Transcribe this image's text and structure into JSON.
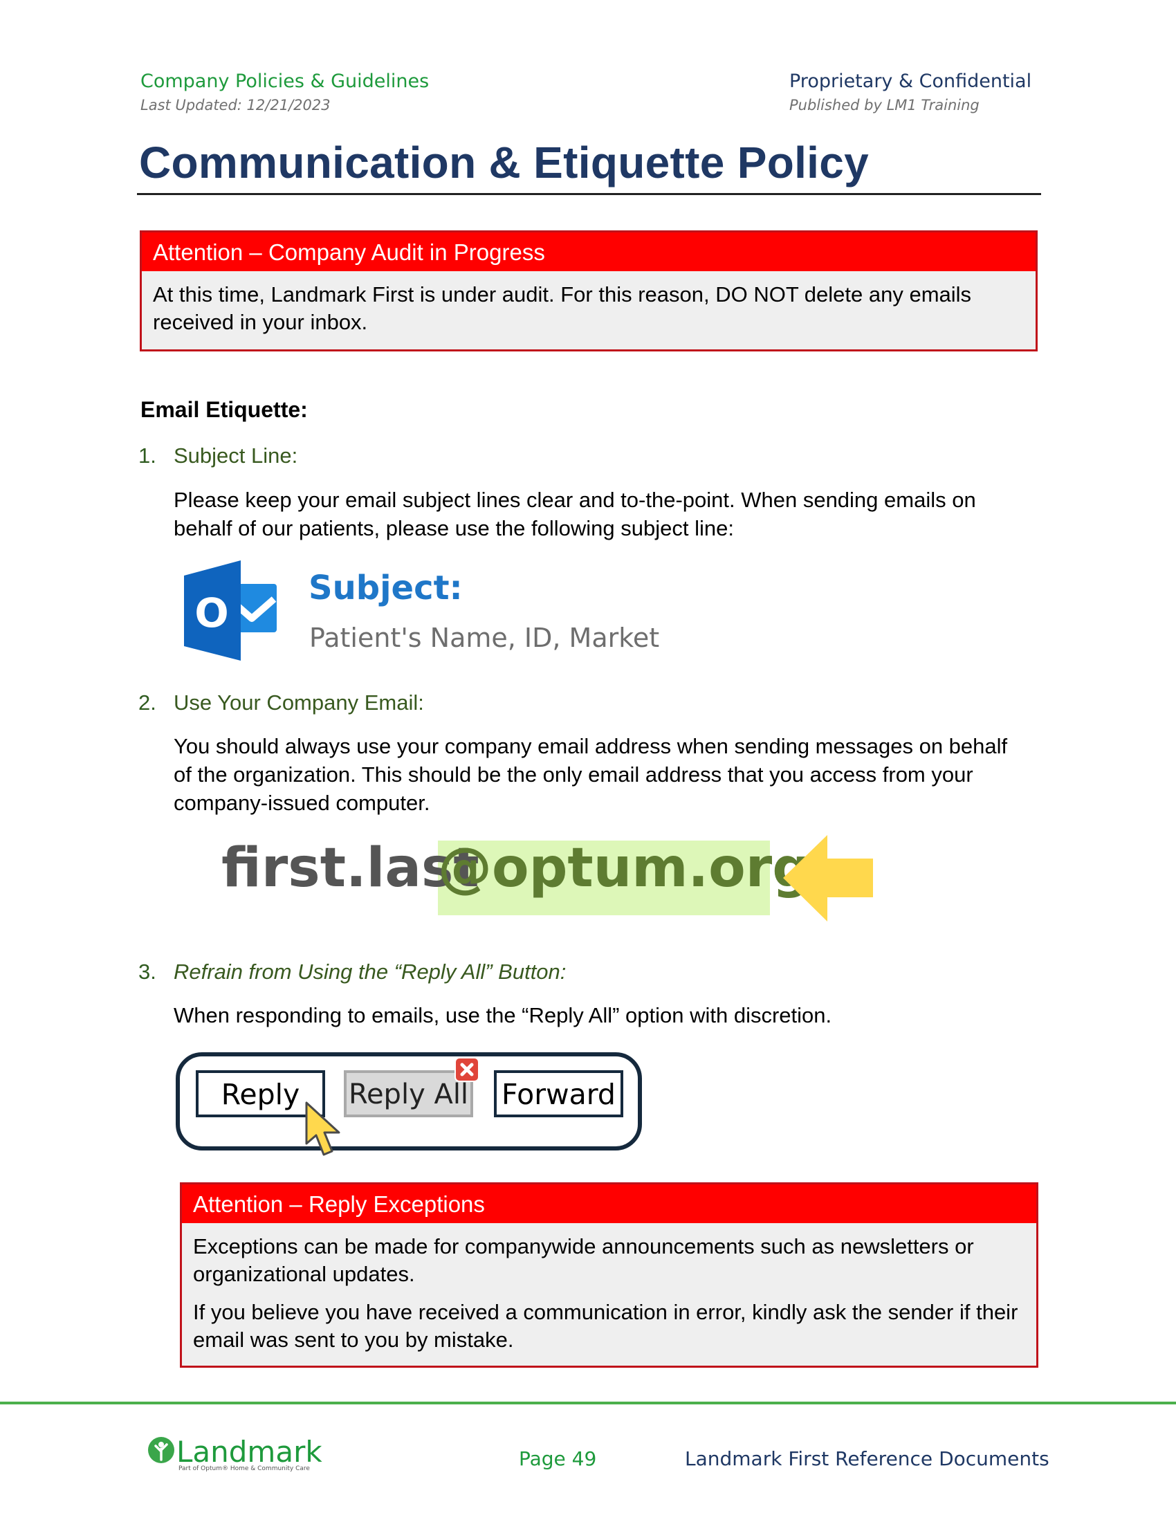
{
  "header": {
    "left_title": "Company Policies & Guidelines",
    "left_subtitle": "Last Updated: 12/21/2023",
    "right_title": "Proprietary & Confidential",
    "right_subtitle": "Published by LM1 Training"
  },
  "title": "Communication & Etiquette Policy",
  "audit_alert": {
    "heading": "Attention – Company Audit in Progress",
    "body": "At this time, Landmark First is under audit. For this reason, DO NOT delete any emails received in your inbox."
  },
  "section_heading": "Email Etiquette:",
  "items": [
    {
      "number": "1.",
      "title": "Subject Line:",
      "text": "Please keep your email subject lines clear and to-the-point. When sending emails on behalf of our patients, please use the following subject line:"
    },
    {
      "number": "2.",
      "title": "Use Your Company Email:",
      "text": "You should always use your company email address when sending messages on behalf of the organization. This should be the only email address that you access from your company-issued computer."
    },
    {
      "number": "3.",
      "title": "Refrain from Using the “Reply All” Button:",
      "text": "When responding to emails, use the “Reply All” option with discretion."
    }
  ],
  "subject_graphic": {
    "label": "Subject:",
    "value": "Patient's Name, ID, Market",
    "icon": "outlook-icon",
    "icon_letter": "O"
  },
  "email_graphic": {
    "local": "first.last",
    "domain": "@optum.org",
    "highlight_color": "#ddf7b8",
    "arrow": "yellow-left-arrow-icon"
  },
  "mail_buttons": {
    "reply": "Reply",
    "reply_all": "Reply All",
    "forward": "Forward"
  },
  "reply_alert": {
    "heading": "Attention – Reply Exceptions",
    "body_1": "Exceptions can be made for companywide announcements such as newsletters or organizational updates.",
    "body_2": "If you believe you have received a communication in error, kindly ask the sender if their email was sent to you by mistake."
  },
  "footer": {
    "logo_text": "Landmark",
    "logo_sub": "Part of Optum® Home & Community Care",
    "page": "Page 49",
    "reference": "Landmark First Reference Documents"
  },
  "colors": {
    "title_navy": "#1f3864",
    "header_green": "#1e9a3c",
    "alert_red": "#ff0000",
    "outlook_blue": "#1f6fc2",
    "arrow_yellow": "#ffd84d"
  }
}
